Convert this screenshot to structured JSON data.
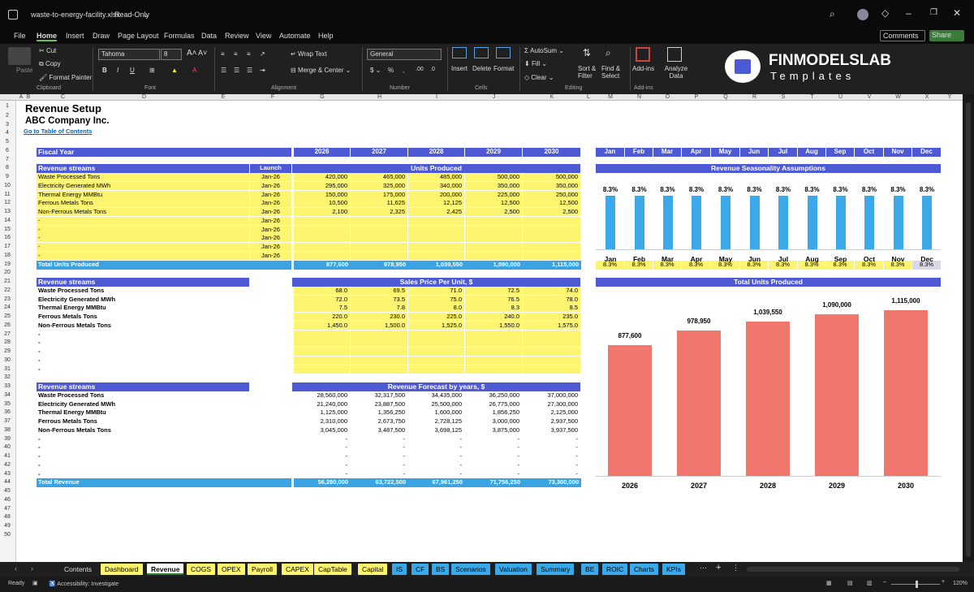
{
  "titlebar": {
    "filename": "waste-to-energy-facility.xlsx",
    "mode": "Read-Only"
  },
  "menu": [
    "File",
    "Home",
    "Insert",
    "Draw",
    "Page Layout",
    "Formulas",
    "Data",
    "Review",
    "View",
    "Automate",
    "Help"
  ],
  "menu_right": {
    "comments": "Comments",
    "share": "Share"
  },
  "ribbon": {
    "paste": "Paste",
    "cut": "Cut",
    "copy": "Copy",
    "format_painter": "Format Painter",
    "clipboard": "Clipboard",
    "font_name": "Tahoma",
    "font_size": "8",
    "font_group": "Font",
    "wrap_text": "Wrap Text",
    "merge_center": "Merge & Center",
    "alignment": "Alignment",
    "number_format": "General",
    "number": "Number",
    "insert": "Insert",
    "delete": "Delete",
    "format": "Format",
    "cells": "Cells",
    "autosum": "AutoSum",
    "fill": "Fill",
    "clear": "Clear",
    "sort_filter": "Sort & Filter",
    "find_select": "Find & Select",
    "editing": "Editing",
    "addins": "Add-ins",
    "addins_group": "Add-ins",
    "analyze": "Analyze Data",
    "logo_main": "FINMODELSLAB",
    "logo_sub": "Templates"
  },
  "columns": [
    "A",
    "B",
    "C",
    "D",
    "E",
    "F",
    "G",
    "H",
    "I",
    "J",
    "K",
    "L",
    "M",
    "N",
    "O",
    "P",
    "Q",
    "R",
    "S",
    "T",
    "U",
    "V",
    "W",
    "X",
    "Y"
  ],
  "rows": [
    "1",
    "2",
    "3",
    "4",
    "5",
    "6",
    "7",
    "8",
    "9",
    "10",
    "11",
    "12",
    "13",
    "14",
    "15",
    "16",
    "17",
    "18",
    "19",
    "20",
    "21",
    "22",
    "23",
    "24",
    "25",
    "26",
    "27",
    "28",
    "29",
    "30",
    "31",
    "32",
    "33",
    "34",
    "35",
    "36",
    "37",
    "38",
    "39",
    "40",
    "41",
    "42",
    "43",
    "44",
    "45",
    "46",
    "47",
    "48",
    "49",
    "50"
  ],
  "sheet": {
    "title": "Revenue Setup",
    "company": "ABC Company Inc.",
    "toc_link": "Go to Table of Contents",
    "fiscal_year": "Fiscal Year",
    "years": [
      "2026",
      "2027",
      "2028",
      "2029",
      "2030"
    ],
    "units": {
      "header": "Revenue streams",
      "launch_hdr": "Launch",
      "section": "Units Produced",
      "rows": [
        {
          "name": "Waste Processed Tons",
          "launch": "Jan-26",
          "v": [
            "420,000",
            "465,000",
            "485,000",
            "500,000",
            "500,000"
          ]
        },
        {
          "name": "Electricity Generated MWh",
          "launch": "Jan-26",
          "v": [
            "295,000",
            "325,000",
            "340,000",
            "350,000",
            "350,000"
          ]
        },
        {
          "name": "Thermal Energy MMBtu",
          "launch": "Jan-26",
          "v": [
            "150,000",
            "175,000",
            "200,000",
            "225,000",
            "250,000"
          ]
        },
        {
          "name": "Ferrous Metals Tons",
          "launch": "Jan-26",
          "v": [
            "10,500",
            "11,625",
            "12,125",
            "12,500",
            "12,500"
          ]
        },
        {
          "name": "Non-Ferrous Metals Tons",
          "launch": "Jan-26",
          "v": [
            "2,100",
            "2,325",
            "2,425",
            "2,500",
            "2,500"
          ]
        },
        {
          "name": "-",
          "launch": "Jan-26",
          "v": [
            "",
            "",
            "",
            "",
            ""
          ]
        },
        {
          "name": "-",
          "launch": "Jan-26",
          "v": [
            "",
            "",
            "",
            "",
            ""
          ]
        },
        {
          "name": "-",
          "launch": "Jan-26",
          "v": [
            "",
            "",
            "",
            "",
            ""
          ]
        },
        {
          "name": "-",
          "launch": "Jan-26",
          "v": [
            "",
            "",
            "",
            "",
            ""
          ]
        },
        {
          "name": "-",
          "launch": "Jan-26",
          "v": [
            "",
            "",
            "",
            "",
            ""
          ]
        }
      ],
      "total_label": "Total Units Produced",
      "totals": [
        "877,600",
        "978,950",
        "1,039,550",
        "1,090,000",
        "1,115,000"
      ]
    },
    "prices": {
      "header": "Revenue streams",
      "section": "Sales Price Per Unit, $",
      "rows": [
        {
          "name": "Waste Processed Tons",
          "v": [
            "68.0",
            "69.5",
            "71.0",
            "72.5",
            "74.0"
          ]
        },
        {
          "name": "Electricity Generated MWh",
          "v": [
            "72.0",
            "73.5",
            "75.0",
            "76.5",
            "78.0"
          ]
        },
        {
          "name": "Thermal Energy MMBtu",
          "v": [
            "7.5",
            "7.8",
            "8.0",
            "8.3",
            "8.5"
          ]
        },
        {
          "name": "Ferrous Metals Tons",
          "v": [
            "220.0",
            "230.0",
            "225.0",
            "240.0",
            "235.0"
          ]
        },
        {
          "name": "Non-Ferrous Metals Tons",
          "v": [
            "1,450.0",
            "1,500.0",
            "1,525.0",
            "1,550.0",
            "1,575.0"
          ]
        },
        {
          "name": "-",
          "v": [
            "",
            "",
            "",
            "",
            ""
          ]
        },
        {
          "name": "-",
          "v": [
            "",
            "",
            "",
            "",
            ""
          ]
        },
        {
          "name": "-",
          "v": [
            "",
            "",
            "",
            "",
            ""
          ]
        },
        {
          "name": "-",
          "v": [
            "",
            "",
            "",
            "",
            ""
          ]
        },
        {
          "name": "-",
          "v": [
            "",
            "",
            "",
            "",
            ""
          ]
        }
      ]
    },
    "revenue": {
      "header": "Revenue streams",
      "section": "Revenue Forecast by years, $",
      "rows": [
        {
          "name": "Waste Processed Tons",
          "v": [
            "28,560,000",
            "32,317,500",
            "34,435,000",
            "36,250,000",
            "37,000,000"
          ]
        },
        {
          "name": "Electricity Generated MWh",
          "v": [
            "21,240,000",
            "23,887,500",
            "25,500,000",
            "26,775,000",
            "27,300,000"
          ]
        },
        {
          "name": "Thermal Energy MMBtu",
          "v": [
            "1,125,000",
            "1,356,250",
            "1,600,000",
            "1,856,250",
            "2,125,000"
          ]
        },
        {
          "name": "Ferrous Metals Tons",
          "v": [
            "2,310,000",
            "2,673,750",
            "2,728,125",
            "3,000,000",
            "2,937,500"
          ]
        },
        {
          "name": "Non-Ferrous Metals Tons",
          "v": [
            "3,045,000",
            "3,487,500",
            "3,698,125",
            "3,875,000",
            "3,937,500"
          ]
        },
        {
          "name": "-",
          "v": [
            "-",
            "-",
            "-",
            "-",
            "-"
          ]
        },
        {
          "name": "-",
          "v": [
            "-",
            "-",
            "-",
            "-",
            "-"
          ]
        },
        {
          "name": "-",
          "v": [
            "-",
            "-",
            "-",
            "-",
            "-"
          ]
        },
        {
          "name": "-",
          "v": [
            "-",
            "-",
            "-",
            "-",
            "-"
          ]
        },
        {
          "name": "-",
          "v": [
            "-",
            "-",
            "-",
            "-",
            "-"
          ]
        }
      ],
      "total_label": "Total Revenue",
      "totals": [
        "56,280,000",
        "63,722,500",
        "67,961,250",
        "71,756,250",
        "73,300,000"
      ]
    },
    "months": [
      "Jan",
      "Feb",
      "Mar",
      "Apr",
      "May",
      "Jun",
      "Jul",
      "Aug",
      "Sep",
      "Oct",
      "Nov",
      "Dec"
    ],
    "seasonality_title": "Revenue Seasonality Assumptions",
    "seasonality_values": [
      "8.3%",
      "8.3%",
      "8.3%",
      "8.3%",
      "8.3%",
      "8.3%",
      "8.3%",
      "8.3%",
      "8.3%",
      "8.3%",
      "8.3%",
      "8.3%"
    ],
    "units_chart_title": "Total Units Produced"
  },
  "chart_data": [
    {
      "type": "bar",
      "title": "Revenue Seasonality Assumptions",
      "categories": [
        "Jan",
        "Feb",
        "Mar",
        "Apr",
        "May",
        "Jun",
        "Jul",
        "Aug",
        "Sep",
        "Oct",
        "Nov",
        "Dec"
      ],
      "values": [
        8.3,
        8.3,
        8.3,
        8.3,
        8.3,
        8.3,
        8.3,
        8.3,
        8.3,
        8.3,
        8.3,
        8.3
      ],
      "data_labels": [
        "8.3%",
        "8.3%",
        "8.3%",
        "8.3%",
        "8.3%",
        "8.3%",
        "8.3%",
        "8.3%",
        "8.3%",
        "8.3%",
        "8.3%",
        "8.3%"
      ],
      "color": "#3ba9e8"
    },
    {
      "type": "bar",
      "title": "Total Units Produced",
      "categories": [
        "2026",
        "2027",
        "2028",
        "2029",
        "2030"
      ],
      "values": [
        877600,
        978950,
        1039550,
        1090000,
        1115000
      ],
      "data_labels": [
        "877,600",
        "978,950",
        "1,039,550",
        "1,090,000",
        "1,115,000"
      ],
      "color": "#f0776b"
    }
  ],
  "tabs": [
    {
      "label": "Contents",
      "color": "#1f1f1f",
      "fg": "#ddd"
    },
    {
      "label": "Dashboard",
      "color": "#fdf470",
      "fg": "#000"
    },
    {
      "label": "Revenue",
      "color": "#ffffff",
      "fg": "#000",
      "active": true
    },
    {
      "label": "COGS",
      "color": "#fdf470",
      "fg": "#000"
    },
    {
      "label": "OPEX",
      "color": "#fdf470",
      "fg": "#000"
    },
    {
      "label": "Payroll",
      "color": "#fdf470",
      "fg": "#000"
    },
    {
      "label": "CAPEX",
      "color": "#fdf470",
      "fg": "#000"
    },
    {
      "label": "CapTable",
      "color": "#fdf470",
      "fg": "#000"
    },
    {
      "label": "Capital",
      "color": "#fdf470",
      "fg": "#000"
    },
    {
      "label": "IS",
      "color": "#3ba9e8",
      "fg": "#000"
    },
    {
      "label": "CF",
      "color": "#3ba9e8",
      "fg": "#000"
    },
    {
      "label": "BS",
      "color": "#3ba9e8",
      "fg": "#000"
    },
    {
      "label": "Scenarios",
      "color": "#3ba9e8",
      "fg": "#000"
    },
    {
      "label": "Valuation",
      "color": "#3ba9e8",
      "fg": "#000"
    },
    {
      "label": "Summary",
      "color": "#3ba9e8",
      "fg": "#000"
    },
    {
      "label": "BE",
      "color": "#3ba9e8",
      "fg": "#000"
    },
    {
      "label": "ROIC",
      "color": "#3ba9e8",
      "fg": "#000"
    },
    {
      "label": "Charts",
      "color": "#3ba9e8",
      "fg": "#000"
    },
    {
      "label": "KPIs",
      "color": "#3ba9e8",
      "fg": "#000"
    }
  ],
  "status": {
    "ready": "Ready",
    "accessibility": "Accessibility: Investigate",
    "zoom": "120%"
  }
}
